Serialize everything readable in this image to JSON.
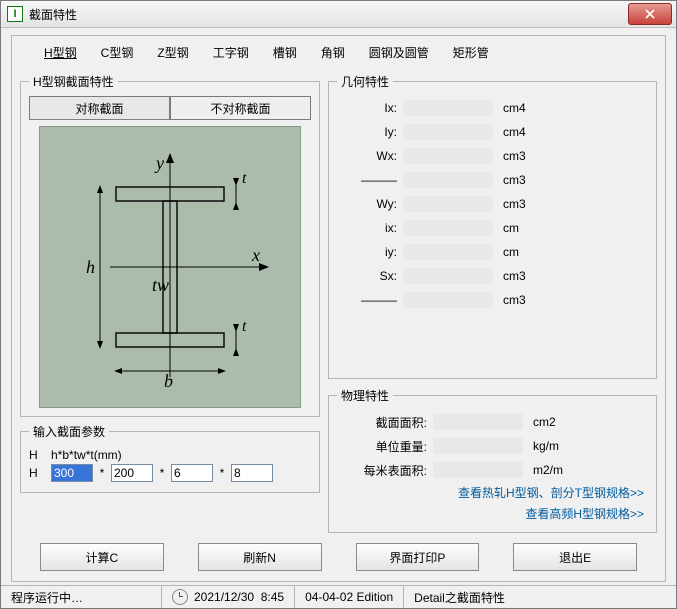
{
  "window": {
    "title": "截面特性"
  },
  "tabs": [
    "H型钢",
    "C型钢",
    "Z型钢",
    "工字钢",
    "槽钢",
    "角钢",
    "圆钢及圆管",
    "矩形管"
  ],
  "section": {
    "group_title": "H型钢截面特性",
    "sym_btn": "对称截面",
    "asym_btn": "不对称截面"
  },
  "diagram": {
    "y": "y",
    "x": "x",
    "h": "h",
    "b": "b",
    "tw": "tw",
    "t1": "t",
    "t2": "t"
  },
  "params": {
    "group_title": "输入截面参数",
    "formula_label": "H",
    "formula": "h*b*tw*t(mm)",
    "row_label": "H",
    "H": "300",
    "B": "200",
    "tw": "6",
    "t": "8",
    "star": "*"
  },
  "geom": {
    "group_title": "几何特性",
    "rows": [
      {
        "l": "Ix:",
        "u": "cm4"
      },
      {
        "l": "Iy:",
        "u": "cm4"
      },
      {
        "l": "Wx:",
        "u": "cm3"
      },
      {
        "l": "———",
        "u": "cm3"
      },
      {
        "l": "Wy:",
        "u": "cm3"
      },
      {
        "l": "ix:",
        "u": "cm"
      },
      {
        "l": "iy:",
        "u": "cm"
      },
      {
        "l": "Sx:",
        "u": "cm3"
      },
      {
        "l": "———",
        "u": "cm3"
      }
    ]
  },
  "phys": {
    "group_title": "物理特性",
    "rows": [
      {
        "l": "截面面积:",
        "u": "cm2"
      },
      {
        "l": "单位重量:",
        "u": "kg/m"
      },
      {
        "l": "每米表面积:",
        "u": "m2/m"
      }
    ],
    "link1": "查看热轧H型钢、剖分T型钢规格>>",
    "link2": "查看高频H型钢规格>>"
  },
  "buttons": {
    "calc": "计算C",
    "refresh": "刷新N",
    "print": "界面打印P",
    "exit": "退出E"
  },
  "status": {
    "running": "程序运行中…",
    "date": "2021/12/30",
    "time": "8:45",
    "edition": "04-04-02 Edition",
    "detail": "Detail之截面特性"
  }
}
